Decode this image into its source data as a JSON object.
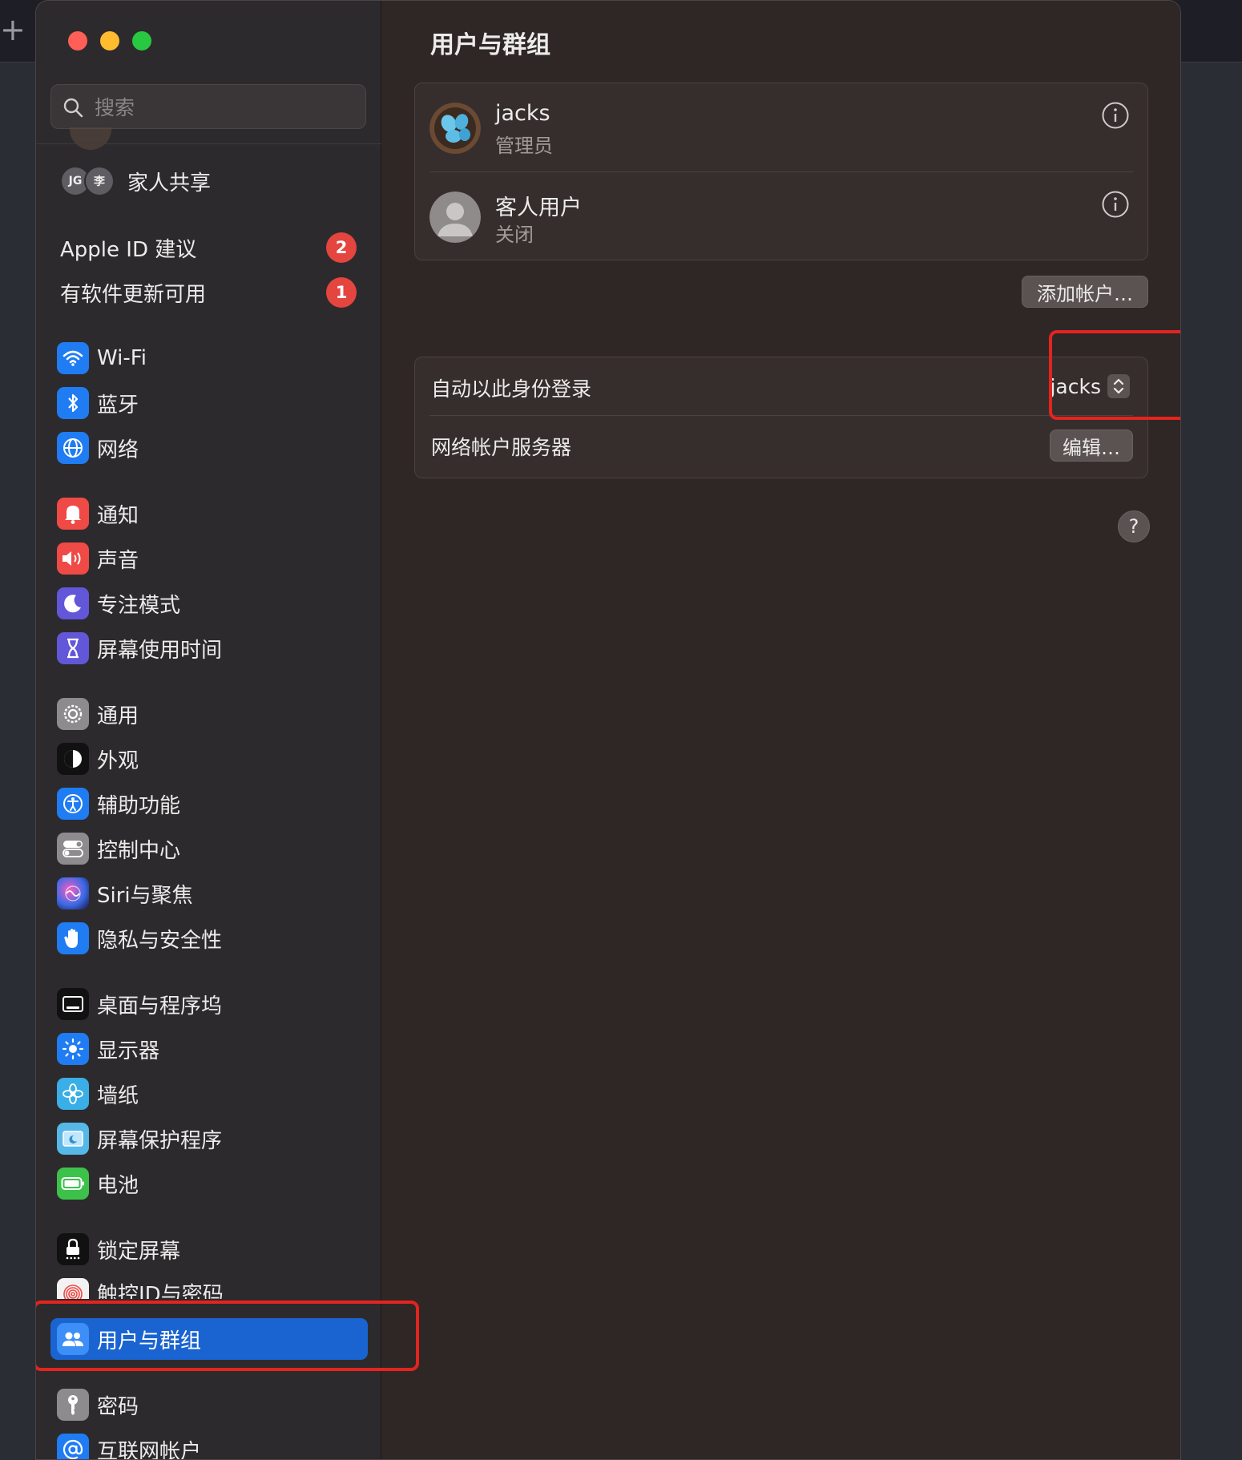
{
  "window": {
    "title": "用户与群组"
  },
  "search": {
    "placeholder": "搜索"
  },
  "family": {
    "initials_1": "JG",
    "initials_2": "李",
    "label": "家人共享"
  },
  "alerts": [
    {
      "label": "Apple ID 建议",
      "count": "2"
    },
    {
      "label": "有软件更新可用",
      "count": "1"
    }
  ],
  "sidebar": {
    "items": [
      {
        "label": "Wi-Fi",
        "icon": "wifi-icon",
        "color": "#1f7cf3"
      },
      {
        "label": "蓝牙",
        "icon": "bluetooth-icon",
        "color": "#1f7cf3"
      },
      {
        "label": "网络",
        "icon": "globe-icon",
        "color": "#1f7cf3"
      },
      {
        "label": "通知",
        "icon": "bell-icon",
        "color": "#ef4a45"
      },
      {
        "label": "声音",
        "icon": "speaker-icon",
        "color": "#ef4a45"
      },
      {
        "label": "专注模式",
        "icon": "moon-icon",
        "color": "#6157d8"
      },
      {
        "label": "屏幕使用时间",
        "icon": "hourglass-icon",
        "color": "#6157d8"
      },
      {
        "label": "通用",
        "icon": "gear-icon",
        "color": "#8d8b8e"
      },
      {
        "label": "外观",
        "icon": "appearance-icon",
        "color": "#111111"
      },
      {
        "label": "辅助功能",
        "icon": "accessibility-icon",
        "color": "#1f7cf3"
      },
      {
        "label": "控制中心",
        "icon": "toggles-icon",
        "color": "#8d8b8e"
      },
      {
        "label": "Siri与聚焦",
        "icon": "siri-icon",
        "color": "#6a3fd0"
      },
      {
        "label": "隐私与安全性",
        "icon": "hand-icon",
        "color": "#1f7cf3"
      },
      {
        "label": "桌面与程序坞",
        "icon": "dock-icon",
        "color": "#111111"
      },
      {
        "label": "显示器",
        "icon": "sun-icon",
        "color": "#1f7cf3"
      },
      {
        "label": "墙纸",
        "icon": "flower-icon",
        "color": "#3aaee6"
      },
      {
        "label": "屏幕保护程序",
        "icon": "screensaver-icon",
        "color": "#55b8e8"
      },
      {
        "label": "电池",
        "icon": "battery-icon",
        "color": "#3cc24b"
      },
      {
        "label": "锁定屏幕",
        "icon": "lock-icon",
        "color": "#111111"
      },
      {
        "label": "触控ID与密码",
        "icon": "fingerprint-icon",
        "color": "#f2f2f2"
      },
      {
        "label": "用户与群组",
        "icon": "users-icon",
        "color": "#1f7cf3"
      },
      {
        "label": "密码",
        "icon": "key-icon",
        "color": "#8d8b8e"
      },
      {
        "label": "互联网帐户",
        "icon": "at-icon",
        "color": "#1f7cf3"
      }
    ]
  },
  "users": [
    {
      "name": "jacks",
      "role": "管理员"
    },
    {
      "name": "客人用户",
      "role": "关闭"
    }
  ],
  "add_account_label": "添加帐户…",
  "auto_login": {
    "label": "自动以此身份登录",
    "value": "jacks"
  },
  "network_server": {
    "label": "网络帐户服务器",
    "button": "编辑…"
  },
  "help_label": "?",
  "colors": {
    "accent": "#1a64d1",
    "highlight": "#e3241f",
    "badge": "#e5453f"
  }
}
